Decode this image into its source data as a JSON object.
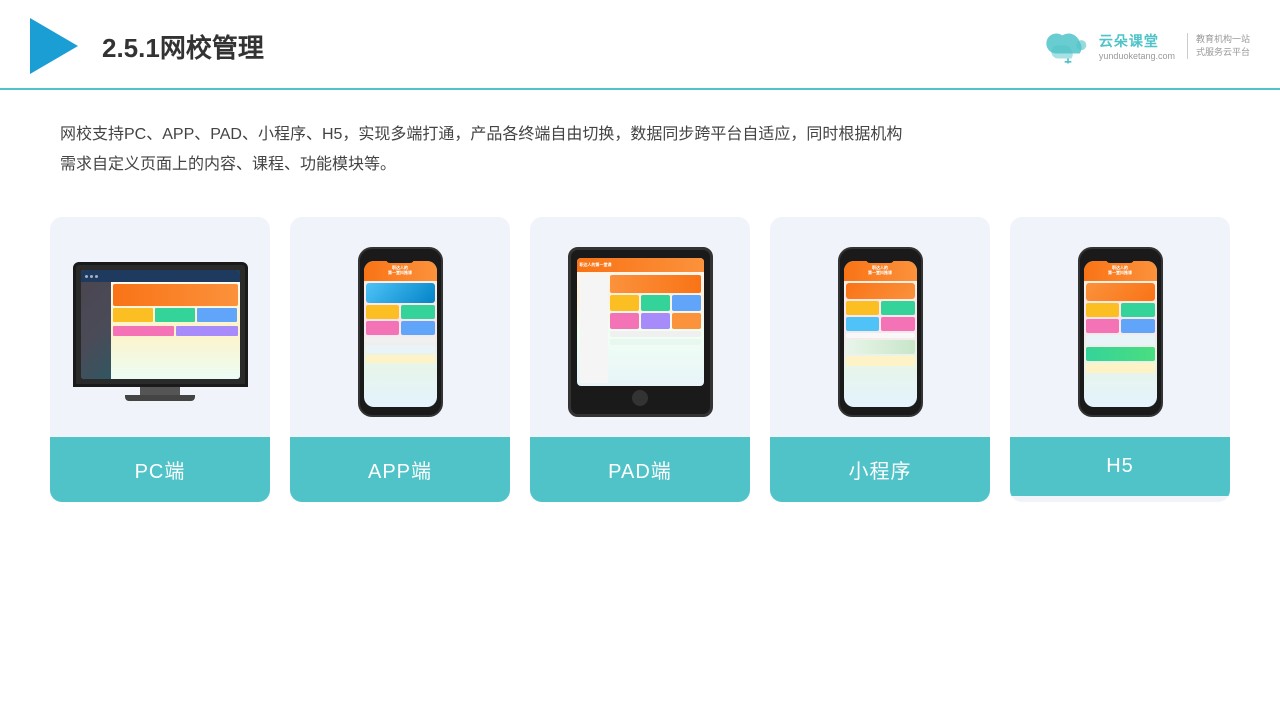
{
  "header": {
    "title": "2.5.1网校管理",
    "brand": {
      "name": "云朵课堂",
      "url": "yunduoketang.com",
      "tagline": "教育机构一站\n式服务云平台"
    }
  },
  "description": "网校支持PC、APP、PAD、小程序、H5，实现多端打通，产品各终端自由切换，数据同步跨平台自适应，同时根据机构\n需求自定义页面上的内容、课程、功能模块等。",
  "devices": [
    {
      "id": "pc",
      "label": "PC端",
      "type": "pc"
    },
    {
      "id": "app",
      "label": "APP端",
      "type": "phone"
    },
    {
      "id": "pad",
      "label": "PAD端",
      "type": "tablet"
    },
    {
      "id": "miniprogram",
      "label": "小程序",
      "type": "phone"
    },
    {
      "id": "h5",
      "label": "H5",
      "type": "phone"
    }
  ],
  "colors": {
    "accent": "#4fc3c8",
    "orange": "#f97316",
    "dark": "#1a1a1a"
  }
}
